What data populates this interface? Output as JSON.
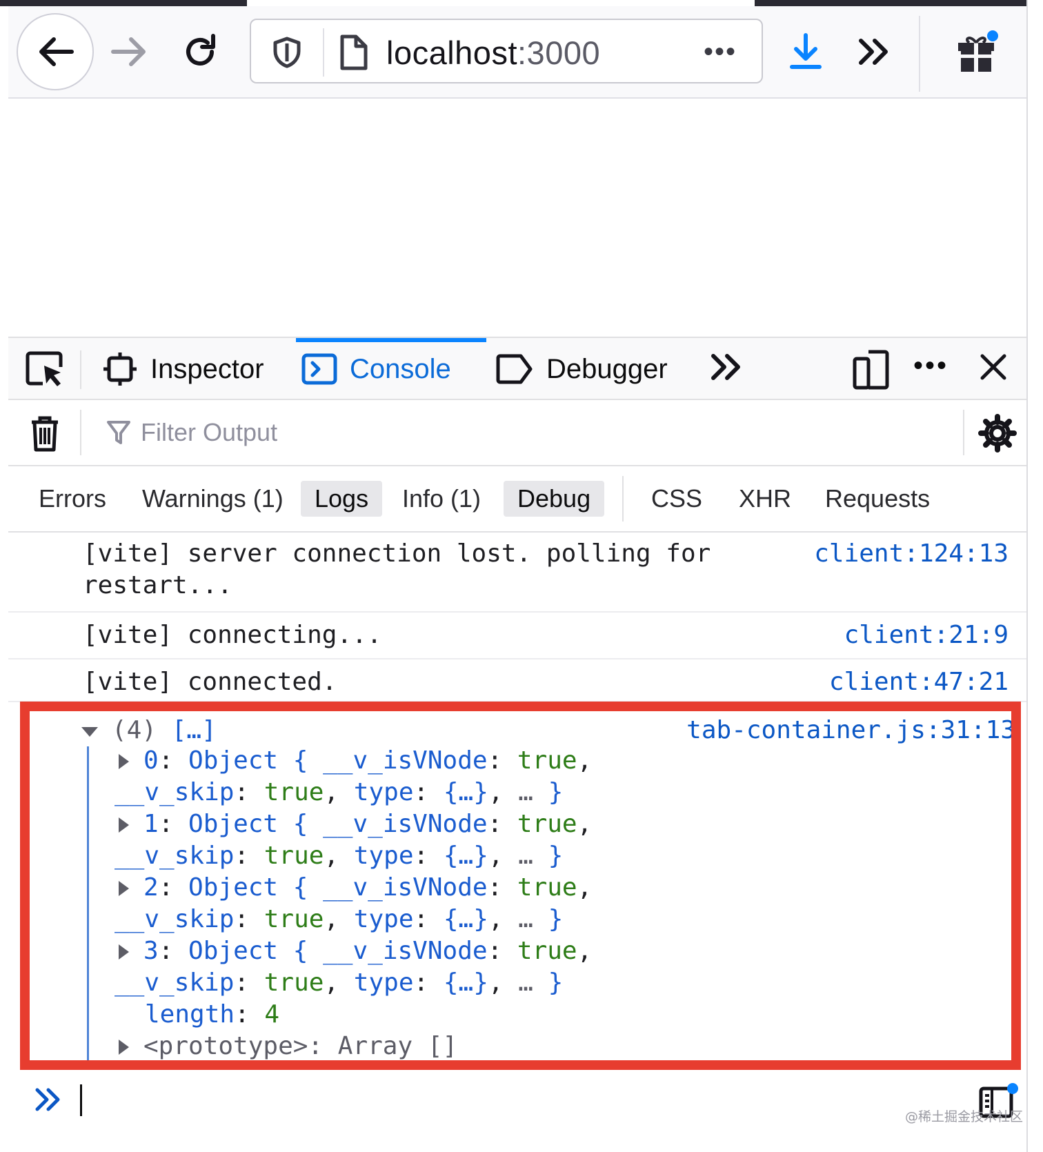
{
  "browser": {
    "url_host": "localhost",
    "url_port": ":3000",
    "url_more": "•••"
  },
  "devtools": {
    "tabs": {
      "inspector": "Inspector",
      "console": "Console",
      "debugger": "Debugger"
    },
    "options": "•••",
    "filter_placeholder": "Filter Output",
    "categories": [
      {
        "label": "Errors",
        "active": false
      },
      {
        "label": "Warnings (1)",
        "active": false
      },
      {
        "label": "Logs",
        "active": true
      },
      {
        "label": "Info (1)",
        "active": false
      },
      {
        "label": "Debug",
        "active": true
      },
      {
        "label": "CSS",
        "active": false
      },
      {
        "label": "XHR",
        "active": false
      },
      {
        "label": "Requests",
        "active": false
      }
    ]
  },
  "console": {
    "messages": [
      {
        "text": "[vite] server connection lost. polling for\nrestart...",
        "location": "client:124:13"
      },
      {
        "text": "[vite] connecting...",
        "location": "client:21:9"
      },
      {
        "text": "[vite] connected.",
        "location": "client:47:21"
      }
    ],
    "object": {
      "summary_count": "(4)",
      "summary_preview": "[…]",
      "location": "tab-container.js:31:13",
      "entries": [
        {
          "index": "0",
          "type": "Object",
          "prop1": "__v_isVNode",
          "val1": "true",
          "prop2": "__v_skip",
          "val2": "true",
          "prop3": "type",
          "val3": "{…}",
          "ellipsis": "…"
        },
        {
          "index": "1",
          "type": "Object",
          "prop1": "__v_isVNode",
          "val1": "true",
          "prop2": "__v_skip",
          "val2": "true",
          "prop3": "type",
          "val3": "{…}",
          "ellipsis": "…"
        },
        {
          "index": "2",
          "type": "Object",
          "prop1": "__v_isVNode",
          "val1": "true",
          "prop2": "__v_skip",
          "val2": "true",
          "prop3": "type",
          "val3": "{…}",
          "ellipsis": "…"
        },
        {
          "index": "3",
          "type": "Object",
          "prop1": "__v_isVNode",
          "val1": "true",
          "prop2": "__v_skip",
          "val2": "true",
          "prop3": "type",
          "val3": "{…}",
          "ellipsis": "…"
        }
      ],
      "length_key": "length",
      "length_value": "4",
      "prototype_key": "<prototype>",
      "prototype_value": "Array []"
    }
  },
  "watermark": "@稀土掘金技术社区",
  "icons": [
    "back-arrow-icon",
    "forward-arrow-icon",
    "reload-icon",
    "shield-icon",
    "page-icon",
    "download-icon",
    "chevron-double-right-icon",
    "gift-icon",
    "element-picker-icon",
    "inspector-icon",
    "console-icon",
    "debugger-icon",
    "responsive-icon",
    "close-icon",
    "trash-icon",
    "filter-icon",
    "gear-icon",
    "prompt-chevron-icon",
    "editor-mode-icon"
  ],
  "colors": {
    "accent": "#0a84ff",
    "highlight_border": "#e73d2f",
    "link": "#0b57c5",
    "string_green": "#2e7d18"
  }
}
